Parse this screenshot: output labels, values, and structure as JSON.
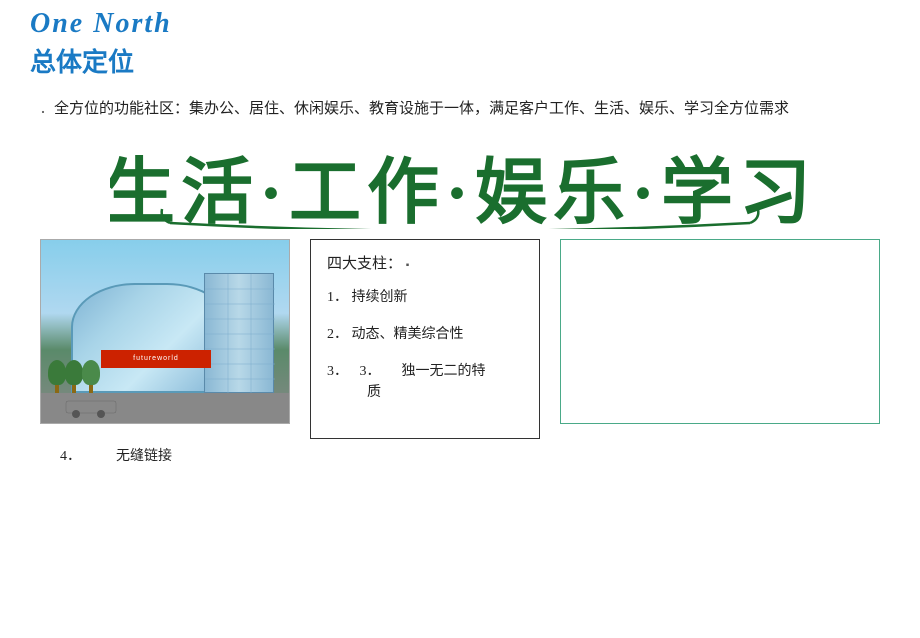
{
  "header": {
    "title_en": "One North",
    "title_zh": "总体定位"
  },
  "bullet": {
    "dot": "·",
    "text": "全方位的功能社区：集办公、居住、休闲娱乐、教育设施于一体，满足客户工作、生活、娱乐、学习全方位需求"
  },
  "slogan": {
    "text": "生活·工作·娱乐·学习"
  },
  "pillars": {
    "title": "四大支柱：",
    "items": [
      {
        "num": "1.",
        "text": "持续创新"
      },
      {
        "num": "2.",
        "text": "动态、精美综合性"
      },
      {
        "num": "3.",
        "text": "3.　　独一无二的特质"
      },
      {
        "num": "4.",
        "text": "　　　无缝链接"
      }
    ]
  },
  "colors": {
    "blue": "#1a7ac4",
    "green_dark": "#1a6e2e",
    "box_border": "#333333",
    "right_box_border": "#4aaa88"
  }
}
